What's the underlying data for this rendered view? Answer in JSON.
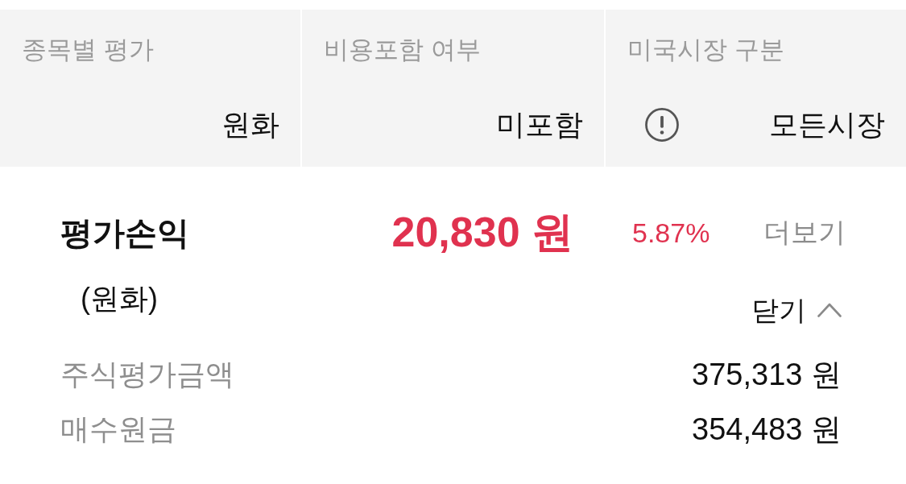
{
  "settings": [
    {
      "label": "종목별 평가",
      "value": "원화",
      "kind": "plain"
    },
    {
      "label": "비용포함 여부",
      "value": "미포함",
      "kind": "plain"
    },
    {
      "label": "미국시장 구분",
      "value": "모든시장",
      "kind": "info"
    }
  ],
  "summary": {
    "title": "평가손익",
    "subtitle": "(원화)",
    "amount": "20,830 원",
    "rate": "5.87%",
    "positive": true,
    "more_link": "더보기",
    "collapse_button": "닫기",
    "expanded": true
  },
  "details": [
    {
      "label": "주식평가금액",
      "value": "375,313 원"
    },
    {
      "label": "매수원금",
      "value": "354,483 원"
    }
  ]
}
